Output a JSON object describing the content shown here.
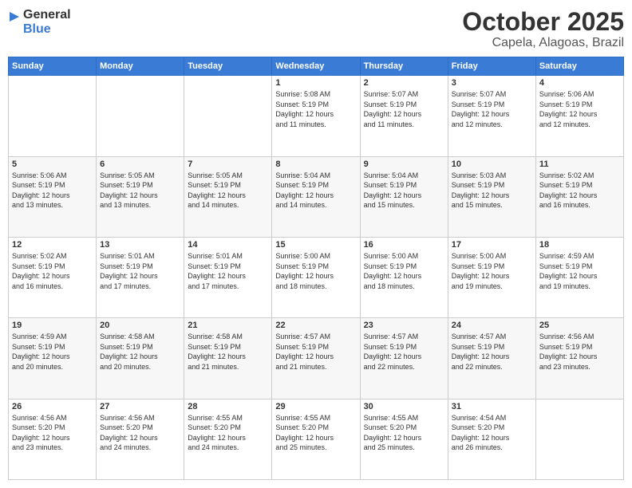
{
  "logo": {
    "line1": "General",
    "line2": "Blue"
  },
  "header": {
    "month": "October 2025",
    "location": "Capela, Alagoas, Brazil"
  },
  "weekdays": [
    "Sunday",
    "Monday",
    "Tuesday",
    "Wednesday",
    "Thursday",
    "Friday",
    "Saturday"
  ],
  "weeks": [
    [
      {
        "day": "",
        "info": ""
      },
      {
        "day": "",
        "info": ""
      },
      {
        "day": "",
        "info": ""
      },
      {
        "day": "1",
        "info": "Sunrise: 5:08 AM\nSunset: 5:19 PM\nDaylight: 12 hours\nand 11 minutes."
      },
      {
        "day": "2",
        "info": "Sunrise: 5:07 AM\nSunset: 5:19 PM\nDaylight: 12 hours\nand 11 minutes."
      },
      {
        "day": "3",
        "info": "Sunrise: 5:07 AM\nSunset: 5:19 PM\nDaylight: 12 hours\nand 12 minutes."
      },
      {
        "day": "4",
        "info": "Sunrise: 5:06 AM\nSunset: 5:19 PM\nDaylight: 12 hours\nand 12 minutes."
      }
    ],
    [
      {
        "day": "5",
        "info": "Sunrise: 5:06 AM\nSunset: 5:19 PM\nDaylight: 12 hours\nand 13 minutes."
      },
      {
        "day": "6",
        "info": "Sunrise: 5:05 AM\nSunset: 5:19 PM\nDaylight: 12 hours\nand 13 minutes."
      },
      {
        "day": "7",
        "info": "Sunrise: 5:05 AM\nSunset: 5:19 PM\nDaylight: 12 hours\nand 14 minutes."
      },
      {
        "day": "8",
        "info": "Sunrise: 5:04 AM\nSunset: 5:19 PM\nDaylight: 12 hours\nand 14 minutes."
      },
      {
        "day": "9",
        "info": "Sunrise: 5:04 AM\nSunset: 5:19 PM\nDaylight: 12 hours\nand 15 minutes."
      },
      {
        "day": "10",
        "info": "Sunrise: 5:03 AM\nSunset: 5:19 PM\nDaylight: 12 hours\nand 15 minutes."
      },
      {
        "day": "11",
        "info": "Sunrise: 5:02 AM\nSunset: 5:19 PM\nDaylight: 12 hours\nand 16 minutes."
      }
    ],
    [
      {
        "day": "12",
        "info": "Sunrise: 5:02 AM\nSunset: 5:19 PM\nDaylight: 12 hours\nand 16 minutes."
      },
      {
        "day": "13",
        "info": "Sunrise: 5:01 AM\nSunset: 5:19 PM\nDaylight: 12 hours\nand 17 minutes."
      },
      {
        "day": "14",
        "info": "Sunrise: 5:01 AM\nSunset: 5:19 PM\nDaylight: 12 hours\nand 17 minutes."
      },
      {
        "day": "15",
        "info": "Sunrise: 5:00 AM\nSunset: 5:19 PM\nDaylight: 12 hours\nand 18 minutes."
      },
      {
        "day": "16",
        "info": "Sunrise: 5:00 AM\nSunset: 5:19 PM\nDaylight: 12 hours\nand 18 minutes."
      },
      {
        "day": "17",
        "info": "Sunrise: 5:00 AM\nSunset: 5:19 PM\nDaylight: 12 hours\nand 19 minutes."
      },
      {
        "day": "18",
        "info": "Sunrise: 4:59 AM\nSunset: 5:19 PM\nDaylight: 12 hours\nand 19 minutes."
      }
    ],
    [
      {
        "day": "19",
        "info": "Sunrise: 4:59 AM\nSunset: 5:19 PM\nDaylight: 12 hours\nand 20 minutes."
      },
      {
        "day": "20",
        "info": "Sunrise: 4:58 AM\nSunset: 5:19 PM\nDaylight: 12 hours\nand 20 minutes."
      },
      {
        "day": "21",
        "info": "Sunrise: 4:58 AM\nSunset: 5:19 PM\nDaylight: 12 hours\nand 21 minutes."
      },
      {
        "day": "22",
        "info": "Sunrise: 4:57 AM\nSunset: 5:19 PM\nDaylight: 12 hours\nand 21 minutes."
      },
      {
        "day": "23",
        "info": "Sunrise: 4:57 AM\nSunset: 5:19 PM\nDaylight: 12 hours\nand 22 minutes."
      },
      {
        "day": "24",
        "info": "Sunrise: 4:57 AM\nSunset: 5:19 PM\nDaylight: 12 hours\nand 22 minutes."
      },
      {
        "day": "25",
        "info": "Sunrise: 4:56 AM\nSunset: 5:19 PM\nDaylight: 12 hours\nand 23 minutes."
      }
    ],
    [
      {
        "day": "26",
        "info": "Sunrise: 4:56 AM\nSunset: 5:20 PM\nDaylight: 12 hours\nand 23 minutes."
      },
      {
        "day": "27",
        "info": "Sunrise: 4:56 AM\nSunset: 5:20 PM\nDaylight: 12 hours\nand 24 minutes."
      },
      {
        "day": "28",
        "info": "Sunrise: 4:55 AM\nSunset: 5:20 PM\nDaylight: 12 hours\nand 24 minutes."
      },
      {
        "day": "29",
        "info": "Sunrise: 4:55 AM\nSunset: 5:20 PM\nDaylight: 12 hours\nand 25 minutes."
      },
      {
        "day": "30",
        "info": "Sunrise: 4:55 AM\nSunset: 5:20 PM\nDaylight: 12 hours\nand 25 minutes."
      },
      {
        "day": "31",
        "info": "Sunrise: 4:54 AM\nSunset: 5:20 PM\nDaylight: 12 hours\nand 26 minutes."
      },
      {
        "day": "",
        "info": ""
      }
    ]
  ]
}
